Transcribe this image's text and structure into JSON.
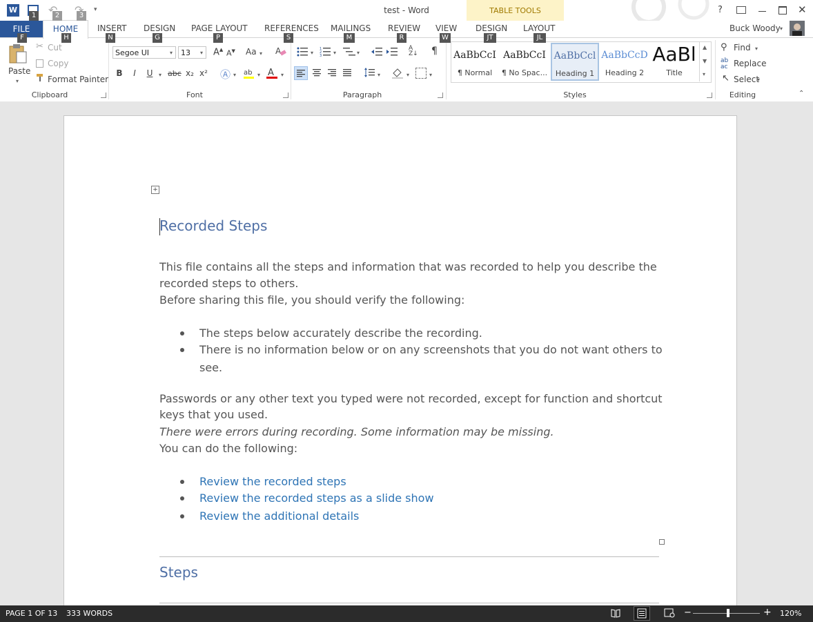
{
  "window": {
    "title": "test - Word",
    "user_name": "Buck Woody",
    "help": "?"
  },
  "keytips": {
    "qat": [
      "1",
      "2",
      "3"
    ],
    "file": "F",
    "home": "H",
    "insert": "N",
    "design": "G",
    "page_layout": "P",
    "references": "S",
    "mailings": "M",
    "review": "R",
    "view": "W",
    "table_design": "JT",
    "table_layout": "JL"
  },
  "tabs": {
    "file": "FILE",
    "home": "HOME",
    "insert": "INSERT",
    "design": "DESIGN",
    "page_layout": "PAGE LAYOUT",
    "references": "REFERENCES",
    "mailings": "MAILINGS",
    "review": "REVIEW",
    "view": "VIEW",
    "table_tools_label": "TABLE TOOLS",
    "table_design": "DESIGN",
    "table_layout": "LAYOUT"
  },
  "clipboard": {
    "paste": "Paste",
    "cut": "Cut",
    "copy": "Copy",
    "format_painter": "Format Painter",
    "group_label": "Clipboard"
  },
  "font": {
    "font_name": "Segoe UI",
    "font_size": "13",
    "bold": "B",
    "italic": "I",
    "underline": "U",
    "strike": "abc",
    "subscript": "x₂",
    "superscript": "x²",
    "case": "Aa",
    "group_label": "Font",
    "highlight_color": "#ffff00",
    "font_color": "#e00000"
  },
  "paragraph": {
    "group_label": "Paragraph",
    "pilcrow": "¶"
  },
  "styles": {
    "group_label": "Styles",
    "items": [
      {
        "preview": "AaBbCcI",
        "name": "¶ Normal"
      },
      {
        "preview": "AaBbCcI",
        "name": "¶ No Spac..."
      },
      {
        "preview": "AaBbCcl",
        "name": "Heading 1"
      },
      {
        "preview": "AaBbCcD",
        "name": "Heading 2"
      },
      {
        "preview": "AaBl",
        "name": "Title"
      }
    ]
  },
  "editing": {
    "find": "Find",
    "replace": "Replace",
    "select": "Select",
    "group_label": "Editing"
  },
  "document": {
    "heading": "Recorded Steps",
    "para1": "This file contains all the steps and information that was recorded to help you describe the",
    "para1b": "recorded steps to others.",
    "para2": "Before sharing this file, you should verify the following:",
    "bullets1": [
      "The steps below accurately describe the recording.",
      "There is no information below or on any screenshots that you do not want others to",
      "see."
    ],
    "para3": "Passwords or any other text you typed were not recorded, except for function and shortcut",
    "para3b": "keys that you used.",
    "para4": "There were errors during recording. Some information may be missing.",
    "para5": "You can do the following:",
    "links": [
      "Review the recorded steps",
      "Review the recorded steps as a slide show",
      "Review the additional details"
    ],
    "heading2": "Steps"
  },
  "status": {
    "page": "PAGE 1 OF 13",
    "words": "333 WORDS",
    "zoom": "120%",
    "zoom_minus": "−",
    "zoom_plus": "+"
  },
  "colors": {
    "accent": "#2b579a",
    "heading": "#4f6fa5",
    "link": "#2e74b5"
  }
}
